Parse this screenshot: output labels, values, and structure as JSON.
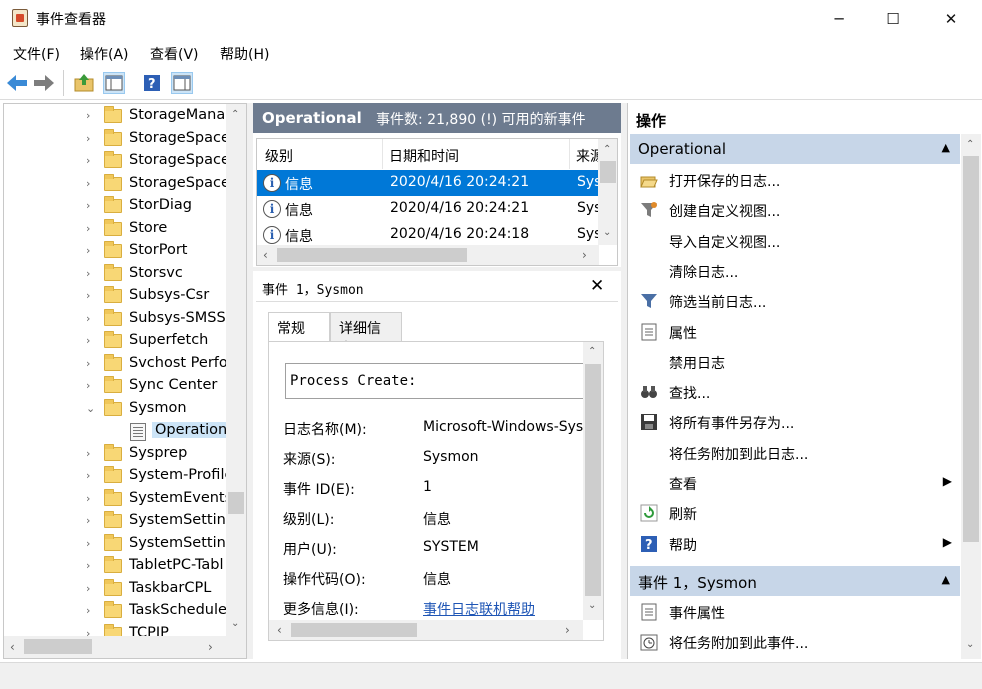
{
  "window": {
    "title": "事件查看器",
    "minimize_glyph": "─",
    "maximize_glyph": "☐",
    "close_glyph": "✕"
  },
  "menu": [
    "文件(F)",
    "操作(A)",
    "查看(V)",
    "帮助(H)"
  ],
  "toolbar": {
    "icons": [
      "back-arrow-icon",
      "forward-arrow-icon",
      "up-folder-icon",
      "show-hide-tree-icon",
      "help-icon",
      "show-hide-action-pane-icon"
    ]
  },
  "tree": {
    "items": [
      {
        "label": "StorageManag",
        "expanded": false
      },
      {
        "label": "StorageSpace",
        "expanded": false
      },
      {
        "label": "StorageSpace",
        "expanded": false
      },
      {
        "label": "StorageSpace",
        "expanded": false
      },
      {
        "label": "StorDiag",
        "expanded": false
      },
      {
        "label": "Store",
        "expanded": false
      },
      {
        "label": "StorPort",
        "expanded": false
      },
      {
        "label": "Storsvc",
        "expanded": false
      },
      {
        "label": "Subsys-Csr",
        "expanded": false
      },
      {
        "label": "Subsys-SMSS",
        "expanded": false
      },
      {
        "label": "Superfetch",
        "expanded": false
      },
      {
        "label": "Svchost Perfor",
        "expanded": false
      },
      {
        "label": "Sync Center",
        "expanded": false
      },
      {
        "label": "Sysmon",
        "expanded": true
      },
      {
        "label": "Operational",
        "expanded": false,
        "child": true
      },
      {
        "label": "Sysprep",
        "expanded": false
      },
      {
        "label": "System-Profile",
        "expanded": false
      },
      {
        "label": "SystemEvents",
        "expanded": false
      },
      {
        "label": "SystemSetting",
        "expanded": false
      },
      {
        "label": "SystemSetting",
        "expanded": false
      },
      {
        "label": "TabletPC-Tabl",
        "expanded": false
      },
      {
        "label": "TaskbarCPL",
        "expanded": false
      },
      {
        "label": "TaskSchedule",
        "expanded": false
      },
      {
        "label": "TCPIP",
        "expanded": false
      }
    ]
  },
  "middle": {
    "log_name": "Operational",
    "event_count": "事件数: 21,890 (!) 可用的新事件",
    "columns": [
      "级别",
      "日期和时间",
      "来源"
    ],
    "events": [
      {
        "level": "信息",
        "datetime": "2020/4/16 20:24:21",
        "source": "Sysmon"
      },
      {
        "level": "信息",
        "datetime": "2020/4/16 20:24:21",
        "source": "Sysmon"
      },
      {
        "level": "信息",
        "datetime": "2020/4/16 20:24:18",
        "source": "Sysmon"
      }
    ],
    "detail_title": "事件 1，Sysmon",
    "tabs": [
      "常规",
      "详细信息"
    ],
    "description": "Process Create:",
    "properties": [
      {
        "label": "日志名称(M):",
        "value": "Microsoft-Windows-Sys"
      },
      {
        "label": "来源(S):",
        "value": "Sysmon"
      },
      {
        "label": "事件 ID(E):",
        "value": "1"
      },
      {
        "label": "级别(L):",
        "value": "信息"
      },
      {
        "label": "用户(U):",
        "value": "SYSTEM"
      },
      {
        "label": "操作代码(O):",
        "value": "信息"
      },
      {
        "label": "更多信息(I):",
        "value": "事件日志联机帮助"
      }
    ]
  },
  "actions": {
    "title": "操作",
    "section1": "Operational",
    "items1": [
      {
        "label": "打开保存的日志...",
        "icon": "open-folder-icon"
      },
      {
        "label": "创建自定义视图...",
        "icon": "filter-create-icon"
      },
      {
        "label": "导入自定义视图...",
        "icon": ""
      },
      {
        "label": "清除日志...",
        "icon": ""
      },
      {
        "label": "筛选当前日志...",
        "icon": "filter-icon"
      },
      {
        "label": "属性",
        "icon": "properties-icon"
      },
      {
        "label": "禁用日志",
        "icon": ""
      },
      {
        "label": "查找...",
        "icon": "binoculars-icon"
      },
      {
        "label": "将所有事件另存为...",
        "icon": "save-icon"
      },
      {
        "label": "将任务附加到此日志...",
        "icon": ""
      },
      {
        "label": "查看",
        "icon": "",
        "submenu": true
      },
      {
        "label": "刷新",
        "icon": "refresh-icon"
      },
      {
        "label": "帮助",
        "icon": "help-icon",
        "submenu": true
      }
    ],
    "section2": "事件 1，Sysmon",
    "items2": [
      {
        "label": "事件属性",
        "icon": "event-properties-icon"
      },
      {
        "label": "将任务附加到此事件...",
        "icon": "task-clock-icon"
      }
    ]
  },
  "colors": {
    "header_bg": "#6d7b8f",
    "section_bg": "#c7d6e8",
    "selection": "#0078d7",
    "link": "#1e55b5"
  }
}
